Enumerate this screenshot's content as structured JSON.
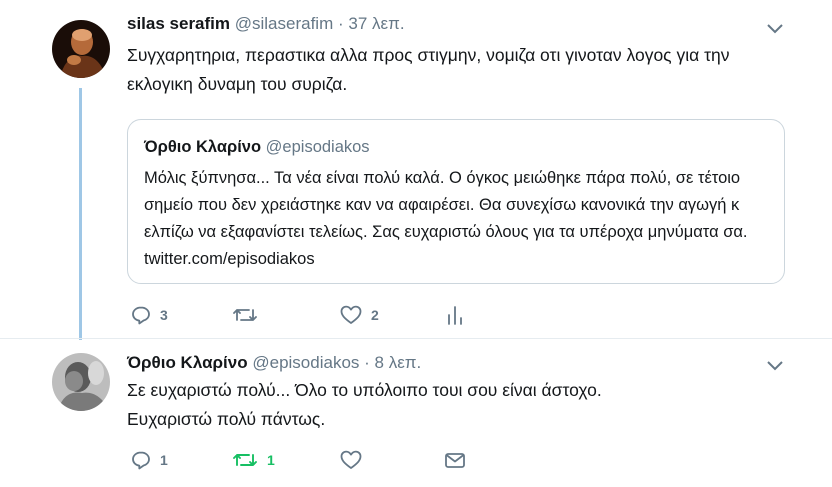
{
  "tweet1": {
    "name": "silas serafim",
    "handle": "@silaserafim",
    "separator": "·",
    "time": "37 λεπ.",
    "text": "Συγχαρητηρια, περαστικα αλλα προς στιγμην, νομιζα οτι γινοταν λογος για την εκλογικη δυναμη του συριζα.",
    "quote": {
      "name": "Όρθιο Κλαρίνο",
      "handle": "@episodiakos",
      "text": "Μόλις ξύπνησα... Τα νέα είναι πολύ καλά. Ο όγκος μειώθηκε πάρα πολύ, σε τέτοιο σημείο που δεν χρειάστηκε καν να αφαιρέσει. Θα συνεχίσω κανονικά την αγωγή κ ελπίζω να εξαφανίστει τελείως. Σας ευχαριστώ όλους για τα υπέροχα μηνύματα σα. twitter.com/episodiakos"
    },
    "actions": {
      "reply_icon": "reply-icon",
      "reply_count": "3",
      "retweet_icon": "retweet-icon",
      "retweet_count": "",
      "like_icon": "heart-icon",
      "like_count": "2",
      "analytics_icon": "analytics-icon"
    }
  },
  "tweet2": {
    "name": "Όρθιο Κλαρίνο",
    "handle": "@episodiakos",
    "separator": "·",
    "time": "8 λεπ.",
    "text": "Σε ευχαριστώ πολύ... Όλο το υπόλοιπο τουι σου είναι άστοχο. Ευχαριστώ πολύ πάντως.",
    "actions": {
      "reply_icon": "reply-icon",
      "reply_count": "1",
      "retweet_icon": "retweet-icon",
      "retweet_count": "1",
      "retweet_active": true,
      "like_icon": "heart-icon",
      "like_count": "",
      "dm_icon": "envelope-icon"
    }
  },
  "colors": {
    "text": "#14171a",
    "secondary": "#657786",
    "thread_line": "#9fc7e6",
    "retweet_active": "#17bf63",
    "border": "#ccd6dd"
  }
}
